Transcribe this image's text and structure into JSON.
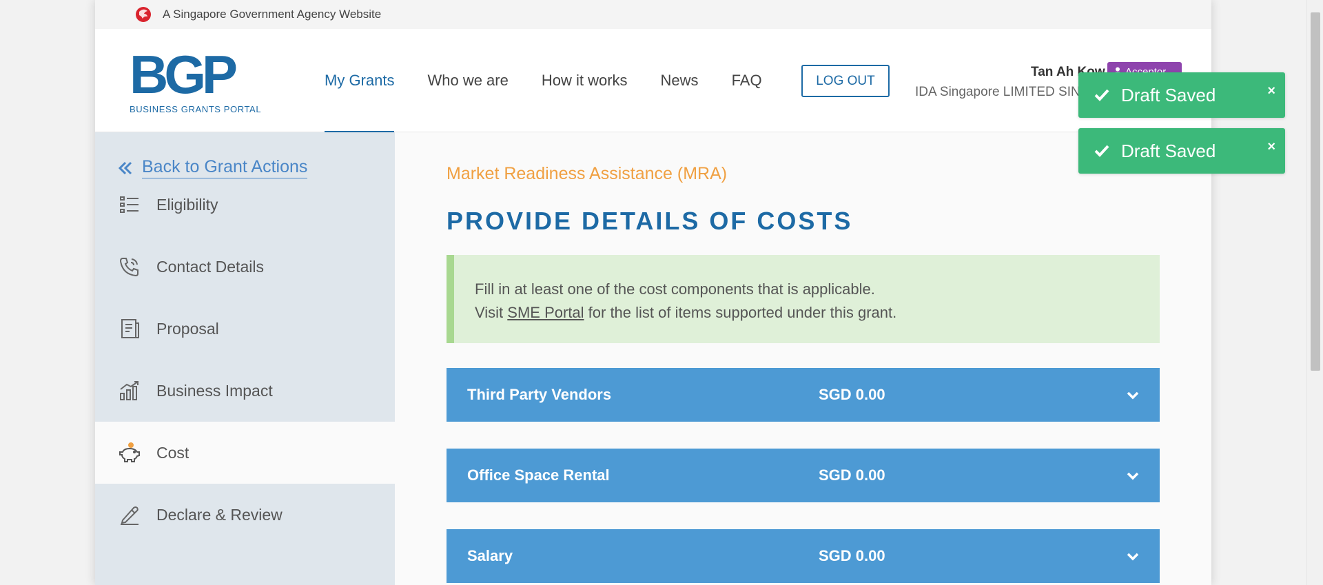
{
  "gov_bar": {
    "text": "A Singapore Government Agency Website"
  },
  "logo": {
    "mark": "BGP",
    "subtitle": "BUSINESS GRANTS PORTAL"
  },
  "nav": {
    "items": [
      {
        "label": "My Grants",
        "active": true
      },
      {
        "label": "Who we are"
      },
      {
        "label": "How it works"
      },
      {
        "label": "News"
      },
      {
        "label": "FAQ"
      }
    ],
    "logout_label": "LOG OUT"
  },
  "user": {
    "name": "Tan Ah Kow",
    "role": "Acceptor",
    "company": "IDA Singapore LIMITED SINGAPORE"
  },
  "sidebar": {
    "back_label": "Back to Grant Actions",
    "items": [
      {
        "label": "Eligibility",
        "icon": "list-icon"
      },
      {
        "label": "Contact Details",
        "icon": "phone-icon"
      },
      {
        "label": "Proposal",
        "icon": "document-icon"
      },
      {
        "label": "Business Impact",
        "icon": "chart-icon"
      },
      {
        "label": "Cost",
        "icon": "piggy-bank-icon",
        "active": true
      },
      {
        "label": "Declare & Review",
        "icon": "pen-icon"
      }
    ]
  },
  "main": {
    "grant_name": "Market Readiness Assistance (MRA)",
    "title": "PROVIDE DETAILS OF COSTS",
    "notice": {
      "line1": "Fill in at least one of the cost components that is applicable.",
      "line2_prefix": "Visit ",
      "line2_link": "SME Portal",
      "line2_suffix": " for the list of items supported under this grant."
    },
    "cost_sections": [
      {
        "label": "Third Party Vendors",
        "amount": "SGD 0.00"
      },
      {
        "label": "Office Space Rental",
        "amount": "SGD 0.00"
      },
      {
        "label": "Salary",
        "amount": "SGD 0.00"
      }
    ]
  },
  "toasts": [
    {
      "message": "Draft Saved",
      "close": "×"
    },
    {
      "message": "Draft Saved",
      "close": "×"
    }
  ],
  "colors": {
    "brand_blue": "#1d6aa5",
    "accordion_blue": "#4d9ad4",
    "grant_orange": "#f0a042",
    "notice_green": "#dff0d8",
    "toast_green": "#3cb97a",
    "role_purple": "#8e44ad"
  }
}
